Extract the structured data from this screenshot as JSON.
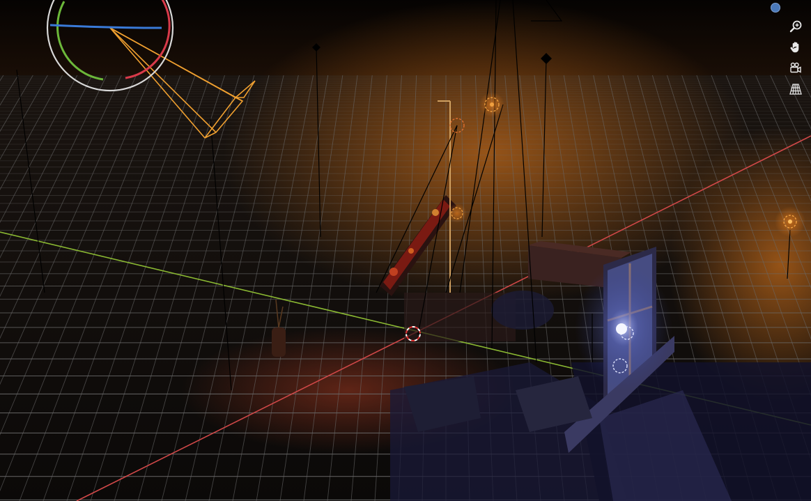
{
  "viewport": {
    "background": "#080604",
    "grid_color": "#6a6a6a",
    "x_axis_color": "#d04848",
    "y_axis_color": "#8ab832"
  },
  "gizmo": {
    "ring_color": "#d8d8d8",
    "x_color": "#d83a4a",
    "y_color": "#6cb83a",
    "z_color": "#3a7ad8"
  },
  "camera": {
    "color": "#f0a030"
  },
  "lights": {
    "warm_color": "#f0a040",
    "cool_color": "#c0c8ff"
  },
  "view_indicator": {
    "color": "#4a78b8"
  },
  "navigation": {
    "buttons": [
      {
        "icon": "zoom-icon"
      },
      {
        "icon": "hand-pan-icon"
      },
      {
        "icon": "camera-view-icon"
      },
      {
        "icon": "perspective-grid-icon"
      }
    ]
  }
}
